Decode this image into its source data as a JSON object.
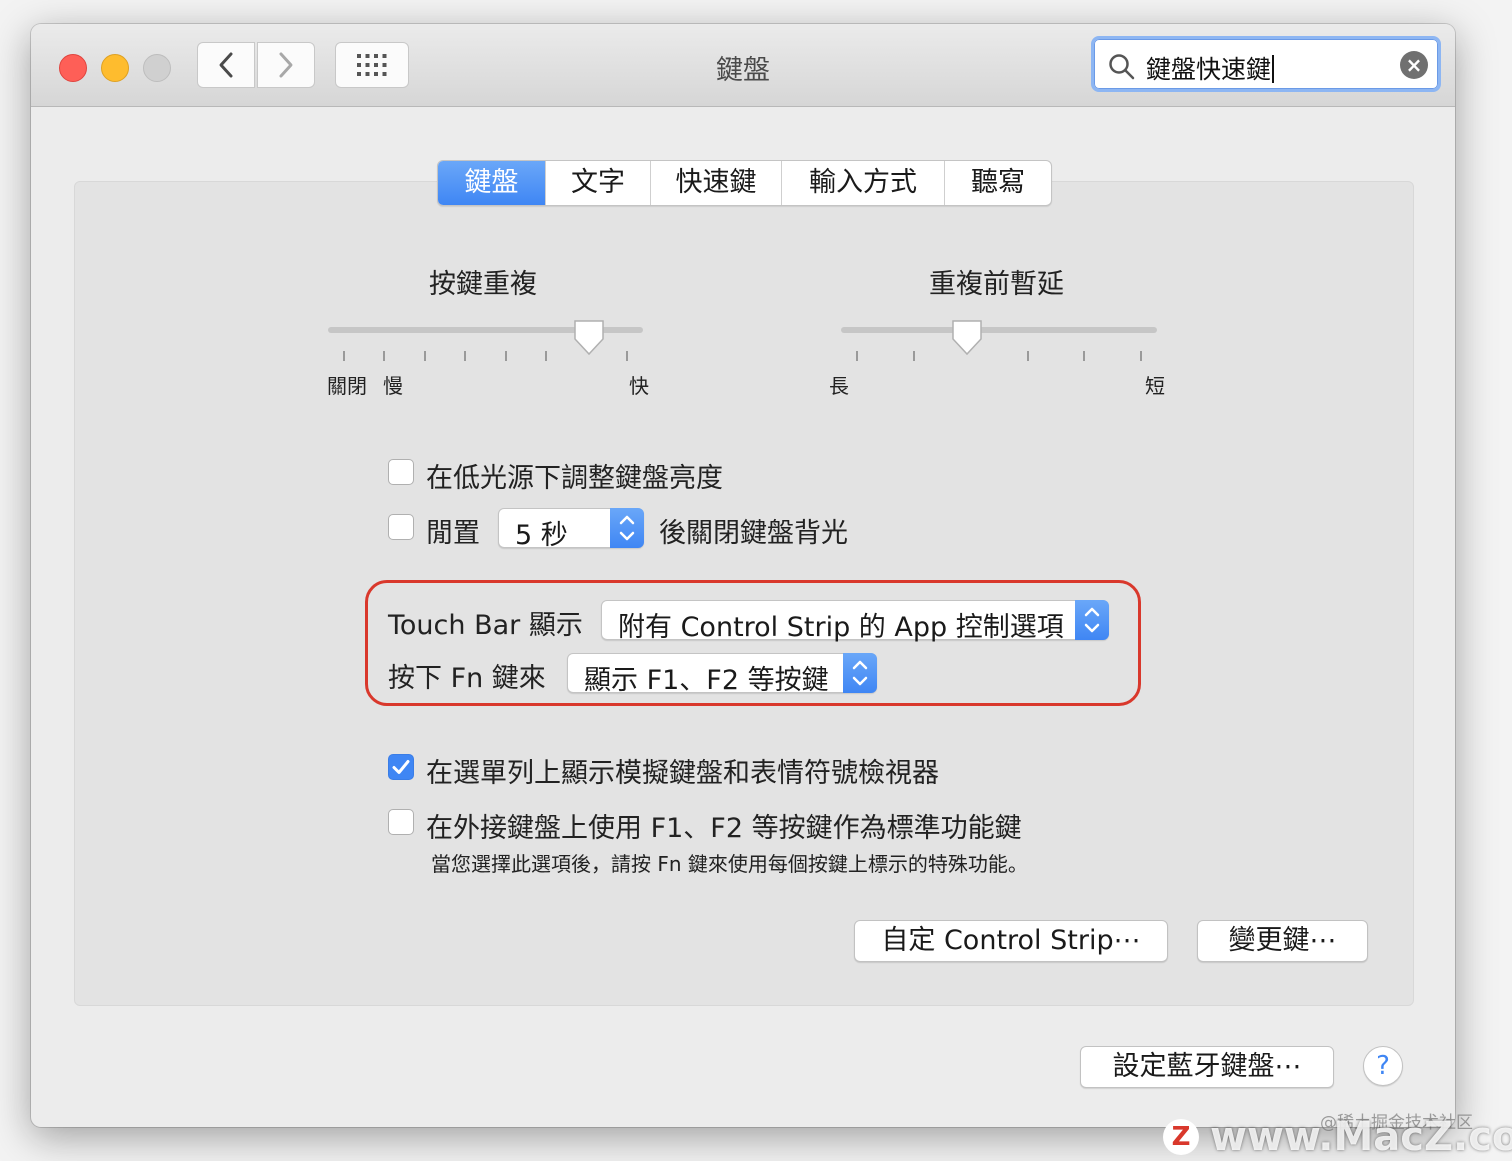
{
  "window": {
    "title": "鍵盤",
    "search": {
      "value": "鍵盤快速鍵"
    }
  },
  "tabs": [
    {
      "label": "鍵盤",
      "active": true
    },
    {
      "label": "文字"
    },
    {
      "label": "快速鍵"
    },
    {
      "label": "輸入方式"
    },
    {
      "label": "聽寫"
    }
  ],
  "key_repeat": {
    "title": "按鍵重複",
    "labels": {
      "off": "關閉",
      "slow": "慢",
      "fast": "快"
    },
    "level_fraction": 0.83
  },
  "delay_until_repeat": {
    "title": "重複前暫延",
    "labels": {
      "long": "長",
      "short": "短"
    },
    "level_fraction": 0.4
  },
  "options": {
    "adjust_brightness": {
      "label": "在低光源下調整鍵盤亮度",
      "checked": false
    },
    "idle_off": {
      "prefix": "閒置",
      "select_value": "5 秒",
      "suffix": "後關閉鍵盤背光",
      "checked": false
    },
    "touch_bar": {
      "label": "Touch Bar 顯示",
      "select_value": "附有 Control Strip 的 App 控制選項"
    },
    "fn_key": {
      "label": "按下 Fn 鍵來",
      "select_value": "顯示 F1、F2 等按鍵"
    },
    "show_viewer": {
      "label": "在選單列上顯示模擬鍵盤和表情符號檢視器",
      "checked": true
    },
    "fn_standard": {
      "label": "在外接鍵盤上使用 F1、F2 等按鍵作為標準功能鍵",
      "note": "當您選擇此選項後，請按 Fn 鍵來使用每個按鍵上標示的特殊功能。",
      "checked": false
    }
  },
  "buttons": {
    "customize_strip": "自定 Control Strip⋯",
    "modifier_keys": "變更鍵⋯",
    "bluetooth": "設定藍牙鍵盤⋯",
    "help": "?"
  },
  "watermark": {
    "text1": "@稀土掘金技术社区",
    "text2": "www.MacZ.com",
    "logo": "Z"
  },
  "colors": {
    "accent": "#3f86f4",
    "highlight": "#d9382c"
  }
}
